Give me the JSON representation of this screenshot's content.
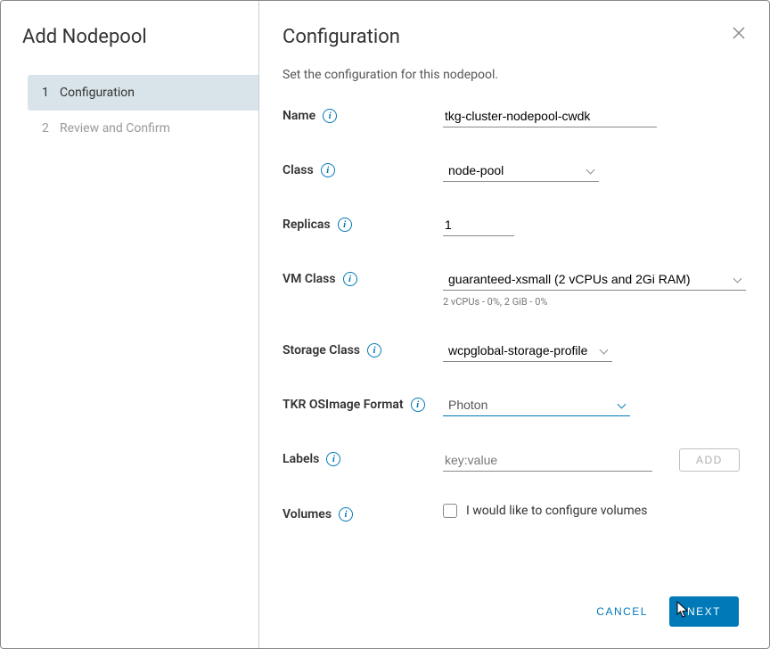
{
  "sidebar": {
    "title": "Add Nodepool",
    "steps": [
      {
        "num": "1",
        "label": "Configuration"
      },
      {
        "num": "2",
        "label": "Review and Confirm"
      }
    ]
  },
  "header": {
    "title": "Configuration"
  },
  "description": "Set the configuration for this nodepool.",
  "form": {
    "name": {
      "label": "Name",
      "value": "tkg-cluster-nodepool-cwdk"
    },
    "class": {
      "label": "Class",
      "value": "node-pool"
    },
    "replicas": {
      "label": "Replicas",
      "value": "1"
    },
    "vmclass": {
      "label": "VM Class",
      "value": "guaranteed-xsmall (2 vCPUs and 2Gi RAM)",
      "helper": "2 vCPUs - 0%, 2 GiB - 0%"
    },
    "storage": {
      "label": "Storage Class",
      "value": "wcpglobal-storage-profile"
    },
    "tkr": {
      "label": "TKR OSImage Format",
      "value": "Photon"
    },
    "labels": {
      "label": "Labels",
      "placeholder": "key:value",
      "add": "ADD"
    },
    "volumes": {
      "label": "Volumes",
      "checkbox_label": "I would like to configure volumes"
    }
  },
  "footer": {
    "cancel": "CANCEL",
    "next": "NEXT"
  }
}
